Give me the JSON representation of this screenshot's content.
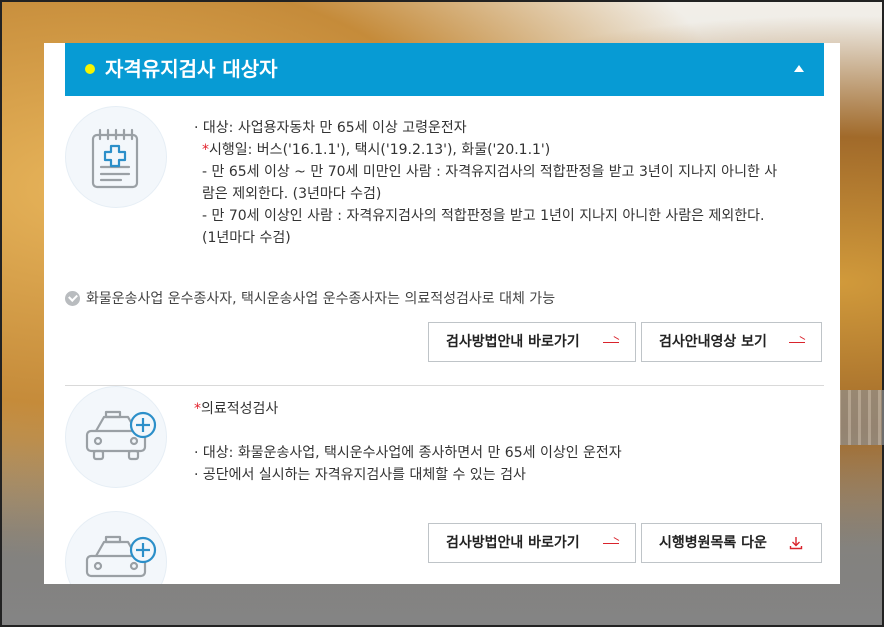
{
  "section": {
    "title": "자격유지검사 대상자"
  },
  "block1": {
    "lines": [
      "· 대상: 사업용자동차 만 65세 이상 고령운전자",
      "시행일: 버스('16.1.1'), 택시('19.2.13'), 화물('20.1.1')",
      "- 만 65세 이상 ~ 만 70세 미만인 사람 : 자격유지검사의 적합판정을 받고 3년이 지나지 아니한 사",
      "람은 제외한다. (3년마다 수검)",
      "- 만 70세 이상인 사람 : 자격유지검사의 적합판정을 받고 1년이 지나지 아니한 사람은 제외한다.",
      "(1년마다 수검)"
    ],
    "note": "화물운송사업 운수종사자, 택시운송사업 운수종사자는 의료적성검사로 대체 가능",
    "buttons": [
      "검사방법안내 바로가기",
      "검사안내영상 보기"
    ]
  },
  "block2": {
    "title": "의료적성검사",
    "lines": [
      "· 대상: 화물운송사업, 택시운수사업에 종사하면서 만 65세 이상인 운전자",
      "· 공단에서 실시하는 자격유지검사를 대체할 수 있는 검사"
    ],
    "buttons": [
      "검사방법안내 바로가기",
      "시행병원목록 다운"
    ]
  },
  "required_mark": "*",
  "colors": {
    "header": "#079bd4",
    "dot": "#f6f400",
    "accent_red": "#e3222c"
  },
  "icons": {
    "document": "document-plus-icon",
    "car": "car-plus-icon",
    "check": "check-circle-icon",
    "arrow": "right-arrow-icon",
    "download": "download-icon"
  }
}
